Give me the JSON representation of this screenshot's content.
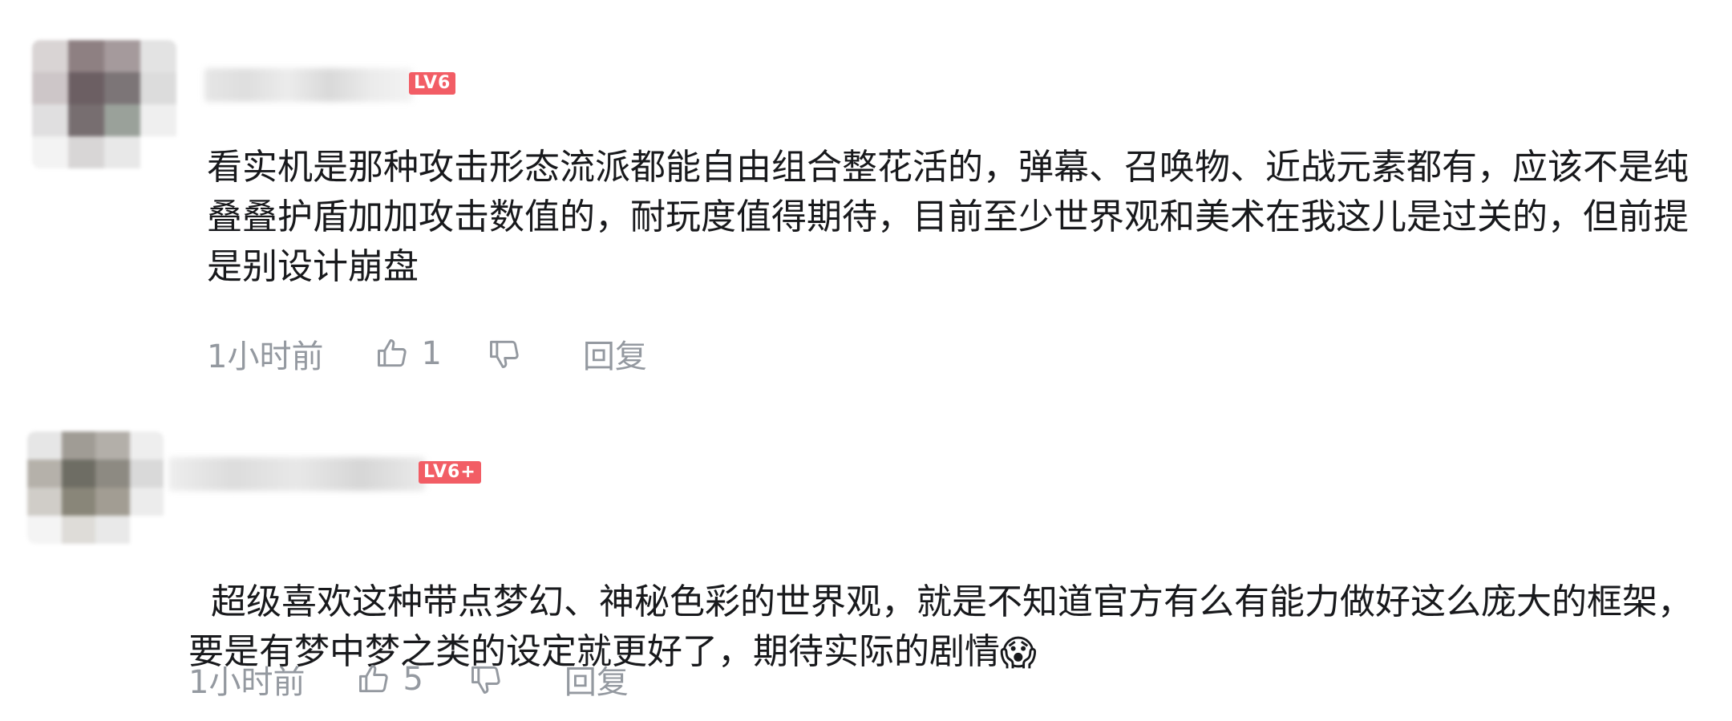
{
  "comments": [
    {
      "level": "LV6",
      "content": "看实机是那种攻击形态流派都能自由组合整花活的，弹幕、召唤物、近战元素都有，应该不是纯叠叠护盾加加攻击数值的，耐玩度值得期待，目前至少世界观和美术在我这儿是过关的，但前提是别设计崩盘",
      "time": "1小时前",
      "likes": "1",
      "reply_label": "回复",
      "like_icon": "thumbs-up-icon",
      "dislike_icon": "thumbs-down-icon"
    },
    {
      "level": "LV6+",
      "content": "超级喜欢这种带点梦幻、神秘色彩的世界观，就是不知道官方有么有能力做好这么庞大的框架，要是有梦中梦之类的设定就更好了，期待实际的剧情",
      "emoji": "😱",
      "time": "1小时前",
      "likes": "5",
      "reply_label": "回复",
      "like_icon": "thumbs-up-icon",
      "dislike_icon": "thumbs-down-icon"
    }
  ],
  "colors": {
    "text": "#18191c",
    "meta": "#9499a0",
    "level_badge": "#f25d65"
  }
}
